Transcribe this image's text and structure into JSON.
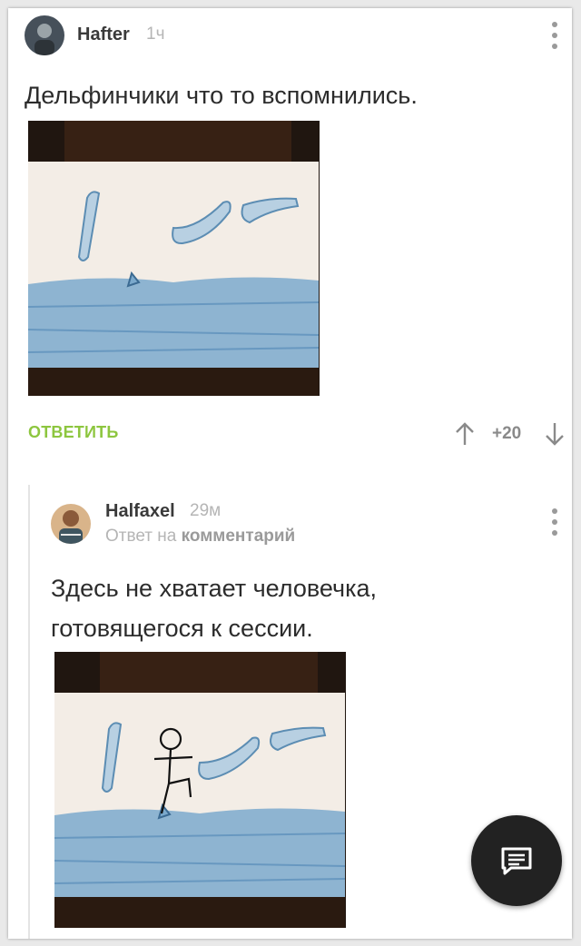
{
  "comment": {
    "author": "Hafter",
    "time": "1ч",
    "text": "Дельфинчики что то вспомнились.",
    "reply_label": "ОТВЕТИТЬ",
    "rating": "+20"
  },
  "reply": {
    "author": "Halfaxel",
    "time": "29м",
    "reply_prefix": "Ответ на",
    "reply_target": "комментарий",
    "text_line1": "Здесь не хватает человечка,",
    "text_line2": "готовящегося к сессии."
  },
  "icons": {
    "menu": "more-vertical-icon",
    "upvote": "arrow-up-icon",
    "downvote": "arrow-down-icon",
    "fab": "comment-icon"
  },
  "colors": {
    "accent": "#8dc63f",
    "text": "#2c2c2c",
    "muted": "#b5b5b5",
    "fab": "#222222"
  }
}
